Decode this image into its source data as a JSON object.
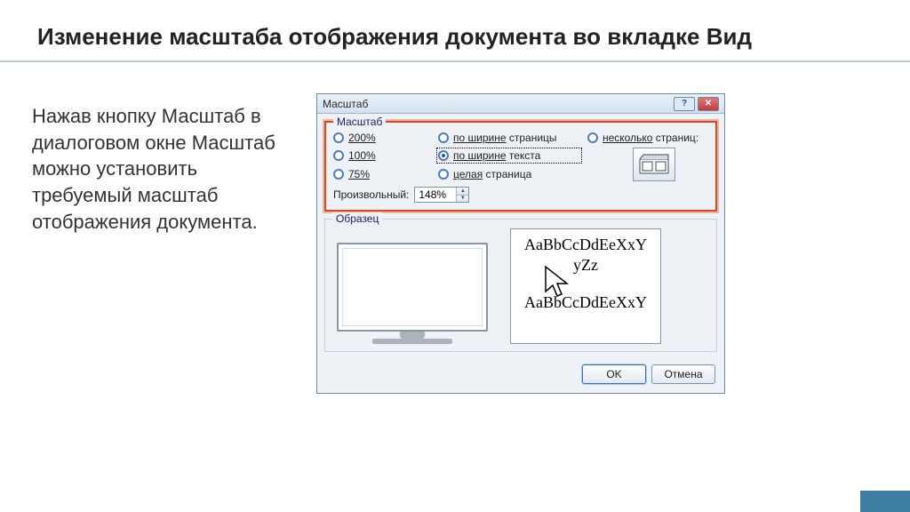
{
  "title": "Изменение масштаба отображения документа во вкладке Вид",
  "description": "Нажав кнопку Масштаб в диалоговом окне Масштаб можно установить требуемый масштаб отображения документа.",
  "dialog": {
    "caption": "Масштаб",
    "help_btn": "?",
    "close_btn": "✕",
    "zoom_legend": "Масштаб",
    "radios": {
      "p200": "200%",
      "p100": "100%",
      "p75": "75%",
      "page_width_prefix": "по ширине",
      "page_width_suffix": " страницы",
      "text_width_prefix": "по ширине",
      "text_width_suffix": " текста",
      "whole_page_prefix": "целая",
      "whole_page_suffix": " страница",
      "many_pages_prefix": "несколько",
      "many_pages_suffix": " страниц:"
    },
    "custom_label": "Произвольный:",
    "custom_value": "148%",
    "sample_legend": "Образец",
    "preview": {
      "line1": "AaBbCcDdEeXxY",
      "line2": "yZz",
      "line3": "AaBbCcDdEeXxY"
    },
    "ok": "OK",
    "cancel": "Отмена"
  }
}
